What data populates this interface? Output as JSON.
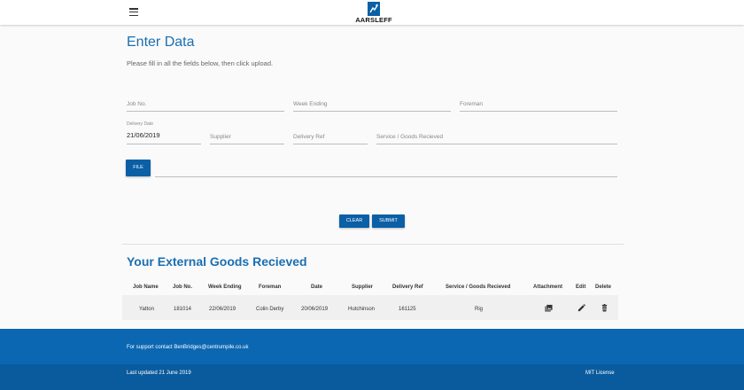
{
  "header": {
    "menu_icon": "hamburger-menu-icon",
    "logo_text": "AARSLEFF",
    "logo_icon": "aarsleff-logo-icon"
  },
  "form": {
    "title": "Enter Data",
    "subtitle": "Please fill in all the fields below, then click upload.",
    "job_no_placeholder": "Job No.",
    "week_ending_placeholder": "Week Ending",
    "foreman_placeholder": "Foreman",
    "delivery_date_label": "Delivery Date",
    "delivery_date_value": "21/06/2019",
    "supplier_placeholder": "Supplier",
    "delivery_ref_placeholder": "Delivery Ref",
    "service_placeholder": "Service / Goods Recieved",
    "file_button": "FILE",
    "clear_button": "CLEAR",
    "submit_button": "SUBMIT"
  },
  "table": {
    "title": "Your External Goods Recieved",
    "headers": [
      "Job Name",
      "Job No.",
      "Week Ending",
      "Foreman",
      "Date",
      "Supplier",
      "Delivery Ref",
      "Service / Goods Recieved",
      "Attachment",
      "Edit",
      "Delete"
    ],
    "rows": [
      {
        "job_name": "Yatton",
        "job_no": "181014",
        "week_ending": "22/06/2019",
        "foreman": "Colin Derby",
        "date": "20/06/2019",
        "supplier": "Hutchinson",
        "delivery_ref": "161125",
        "service": "Rig",
        "attachment_icon": "attachment-image-icon",
        "edit_icon": "edit-pencil-icon",
        "delete_icon": "trash-icon"
      }
    ]
  },
  "footer": {
    "support": "For support contact BenBridges@centrumpile.co.uk",
    "updated": "Last updated 21 June 2019",
    "license": "MIT License"
  },
  "colors": {
    "primary": "#0b5fa5",
    "title": "#1a6fb3",
    "footer_top": "#0b67b2",
    "footer_bottom": "#0a5b9e"
  }
}
